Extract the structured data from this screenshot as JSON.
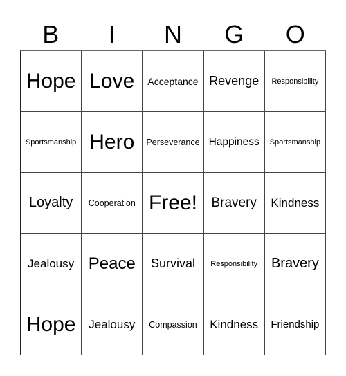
{
  "header": {
    "letters": [
      "B",
      "I",
      "N",
      "G",
      "O"
    ]
  },
  "grid": {
    "rows": [
      [
        "Hope",
        "Love",
        "Acceptance",
        "Revenge",
        "Responsibility"
      ],
      [
        "Sportsmanship",
        "Hero",
        "Perseverance",
        "Happiness",
        "Sportsmanship"
      ],
      [
        "Loyalty",
        "Cooperation",
        "Free!",
        "Bravery",
        "Kindness"
      ],
      [
        "Jealousy",
        "Peace",
        "Survival",
        "Responsibility",
        "Bravery"
      ],
      [
        "Hope",
        "Jealousy",
        "Compassion",
        "Kindness",
        "Friendship"
      ]
    ]
  },
  "colors": {
    "text": "#000000",
    "background": "#ffffff",
    "grid_line": "#444444"
  }
}
